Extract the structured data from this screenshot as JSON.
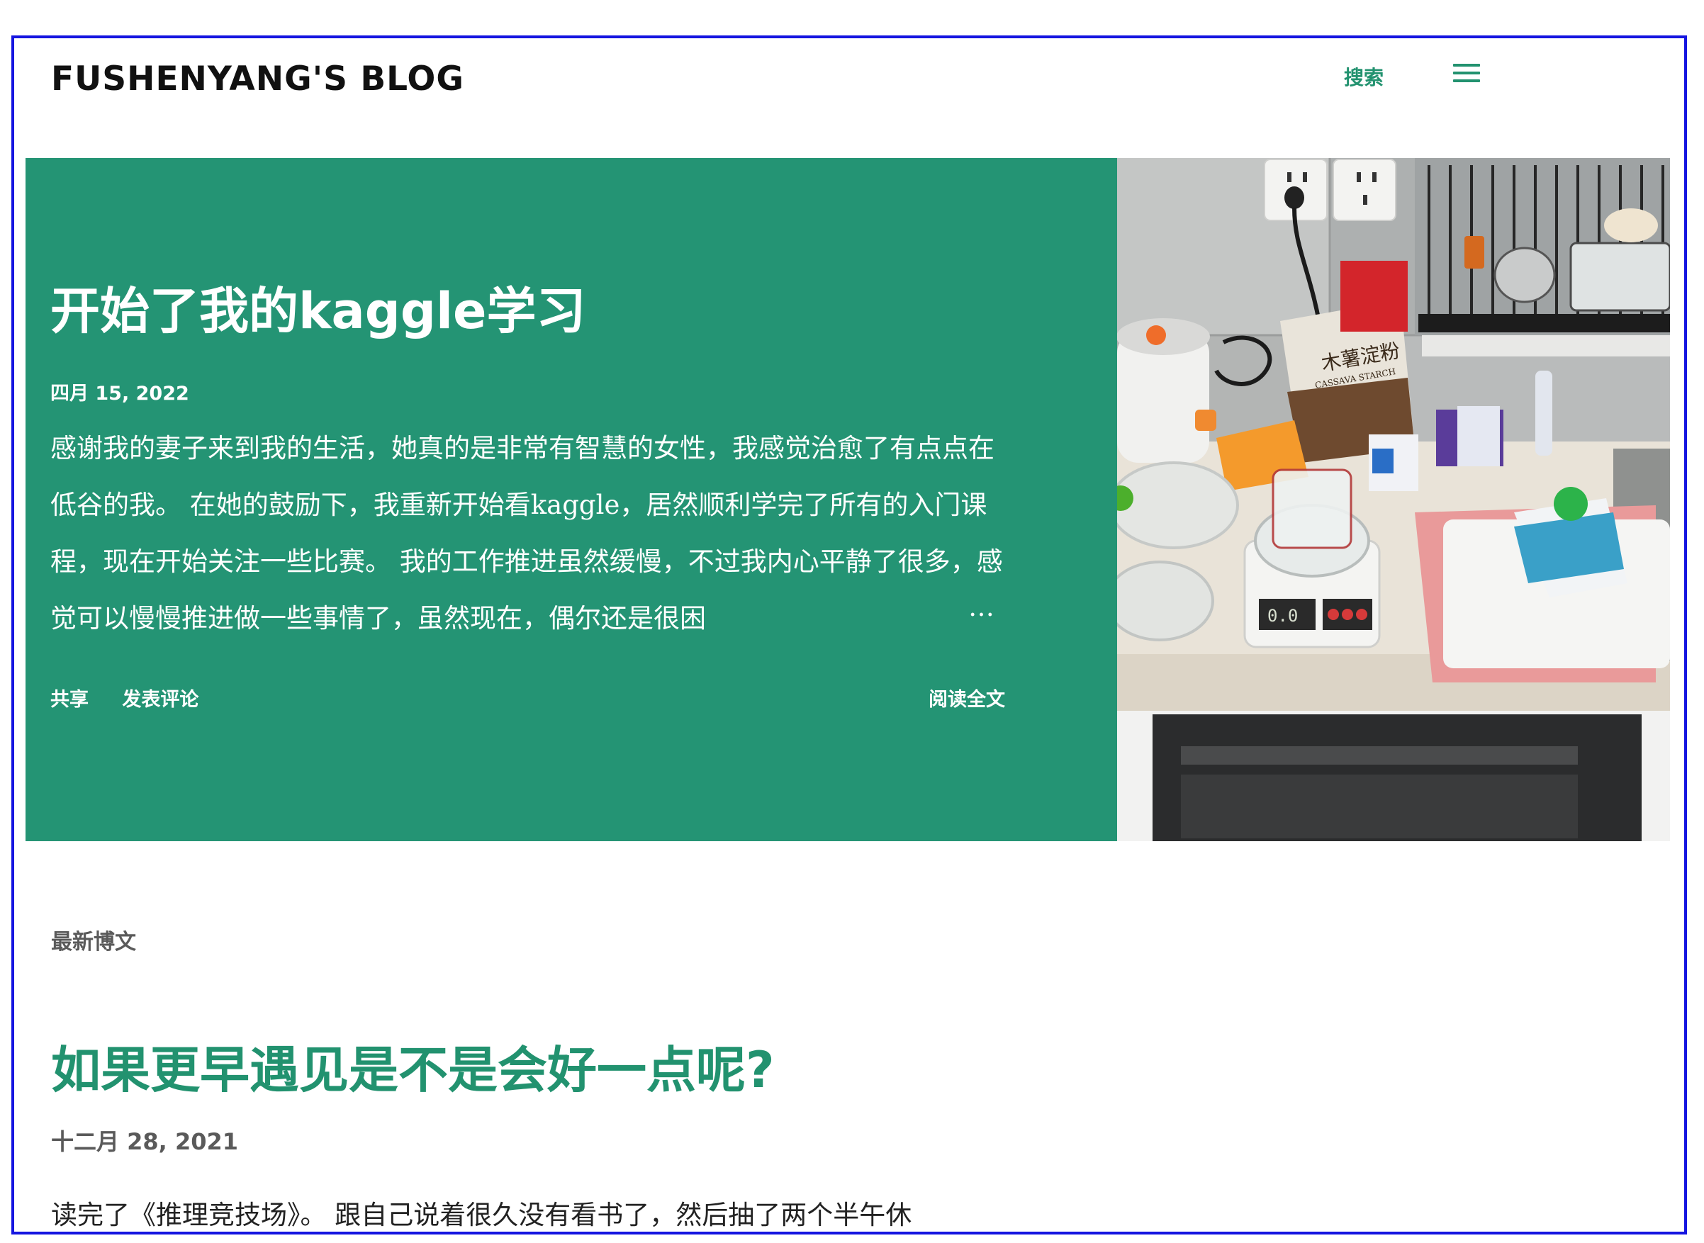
{
  "site": {
    "title": "FUSHENYANG'S BLOG",
    "search_label": "搜索"
  },
  "featured": {
    "title": "开始了我的kaggle学习",
    "date": "四月 15, 2022",
    "snippet": " 感谢我的妻子来到我的生活，她真的是非常有智慧的女性，我感觉治愈了有点点在低谷的我。 在她的鼓励下，我重新开始看kaggle，居然顺利学完了所有的入门课程，现在开始关注一些比赛。 我的工作推进虽然缓慢，不过我内心平静了很多，感觉可以慢慢推进做一些事情了，虽然现在，偶尔还是很困",
    "ellipsis": "…",
    "share_label": "共享",
    "comment_label": "发表评论",
    "read_more_label": "阅读全文",
    "image_text": {
      "bag_label": "木薯淀粉",
      "bag_sublabel": "CASSAVA STARCH",
      "scale_reading": "0.0"
    },
    "accent_color": "#249474"
  },
  "latest": {
    "section_label": "最新博文",
    "post": {
      "title": "如果更早遇见是不是会好一点呢?",
      "date": "十二月 28, 2021",
      "snippet": "读完了《推理竞技场》。 跟自己说着很久没有看书了，然后抽了两个半午休"
    }
  },
  "colors": {
    "accent": "#22926f",
    "frame_border": "#1515e0"
  },
  "icons": {
    "menu": "hamburger-menu-icon"
  }
}
